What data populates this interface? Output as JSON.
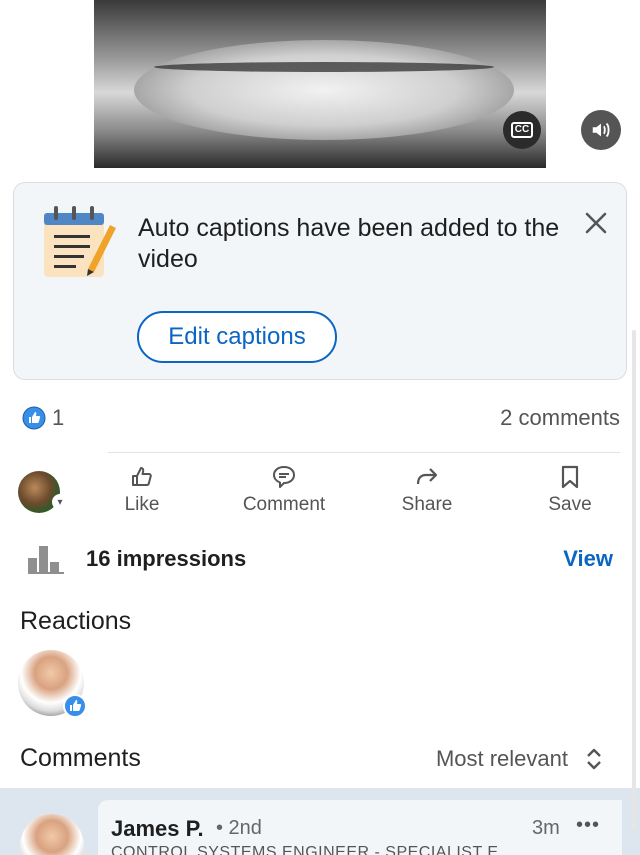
{
  "video": {
    "cc_label": "CC"
  },
  "caption_card": {
    "message": "Auto captions have been added to the video",
    "edit_button": "Edit captions"
  },
  "social": {
    "like_count": "1",
    "comments_count": "2 comments"
  },
  "actions": [
    {
      "label": "Like",
      "icon": "like-icon"
    },
    {
      "label": "Comment",
      "icon": "comment-icon"
    },
    {
      "label": "Share",
      "icon": "share-icon"
    },
    {
      "label": "Save",
      "icon": "bookmark-icon"
    }
  ],
  "impressions": {
    "text": "16 impressions",
    "view_label": "View"
  },
  "reactions": {
    "title": "Reactions"
  },
  "comments": {
    "title": "Comments",
    "sort_label": "Most relevant",
    "items": [
      {
        "name": "James P.",
        "degree": "• 2nd",
        "time": "3m",
        "more": "•••",
        "headline": "CONTROL SYSTEMS ENGINEER - SPECIALIST E"
      }
    ]
  },
  "colors": {
    "accent": "#0a66c2",
    "card_bg": "#f3f6f8",
    "comment_highlight": "#dde6ee"
  }
}
